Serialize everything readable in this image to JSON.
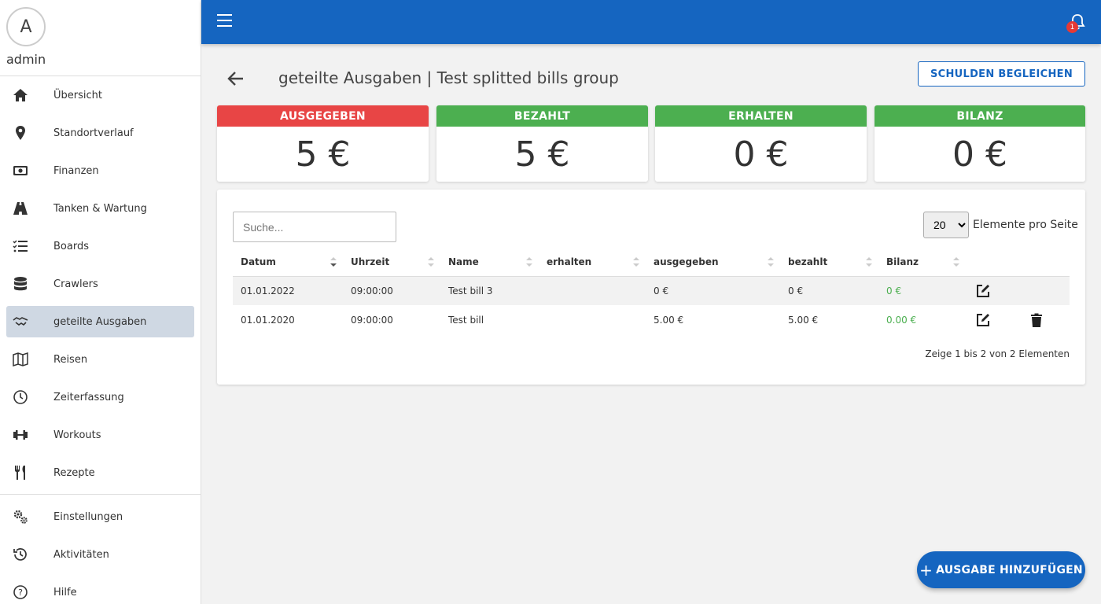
{
  "sidebar": {
    "avatar_letter": "A",
    "username": "admin",
    "items": [
      {
        "label": "Übersicht",
        "icon": "home-icon"
      },
      {
        "label": "Standortverlauf",
        "icon": "map-pin-icon"
      },
      {
        "label": "Finanzen",
        "icon": "money-icon"
      },
      {
        "label": "Tanken & Wartung",
        "icon": "road-icon"
      },
      {
        "label": "Boards",
        "icon": "checklist-icon"
      },
      {
        "label": "Crawlers",
        "icon": "database-icon"
      },
      {
        "label": "geteilte Ausgaben",
        "icon": "handshake-icon",
        "active": true
      },
      {
        "label": "Reisen",
        "icon": "map-icon"
      },
      {
        "label": "Zeiterfassung",
        "icon": "clock-icon"
      },
      {
        "label": "Workouts",
        "icon": "dumbbell-icon"
      },
      {
        "label": "Rezepte",
        "icon": "utensils-icon"
      }
    ],
    "bottom_items": [
      {
        "label": "Einstellungen",
        "icon": "gears-icon"
      },
      {
        "label": "Aktivitäten",
        "icon": "history-icon"
      },
      {
        "label": "Hilfe",
        "icon": "help-icon"
      }
    ]
  },
  "topbar": {
    "menu_icon": "hamburger-icon",
    "notification_icon": "bell-icon",
    "notification_count": "1",
    "color": "#1565c0"
  },
  "page": {
    "title": "geteilte Ausgaben | Test splitted bills group",
    "settle_button": "SCHULDEN BEGLEICHEN"
  },
  "stats": [
    {
      "label": "AUSGEGEBEN",
      "value": "5 €",
      "color": "#e84545"
    },
    {
      "label": "BEZAHLT",
      "value": "5 €",
      "color": "#4caf50"
    },
    {
      "label": "ERHALTEN",
      "value": "0 €",
      "color": "#4caf50"
    },
    {
      "label": "BILANZ",
      "value": "0 €",
      "color": "#4caf50"
    }
  ],
  "table": {
    "search_placeholder": "Suche...",
    "per_page_value": "20",
    "per_page_label": "Elemente pro Seite",
    "columns": [
      "Datum",
      "Uhrzeit",
      "Name",
      "erhalten",
      "ausgegeben",
      "bezahlt",
      "Bilanz"
    ],
    "rows": [
      {
        "date": "01.01.2022",
        "time": "09:00:00",
        "name": "Test bill 3",
        "received": "",
        "spent": "0 €",
        "paid": "0 €",
        "balance": "0 €"
      },
      {
        "date": "01.01.2020",
        "time": "09:00:00",
        "name": "Test bill",
        "received": "",
        "spent": "5.00 €",
        "paid": "5.00 €",
        "balance": "0.00 €"
      }
    ],
    "footer": "Zeige 1 bis 2 von 2 Elementen"
  },
  "fab": {
    "label": "AUSGABE HINZUFÜGEN"
  }
}
